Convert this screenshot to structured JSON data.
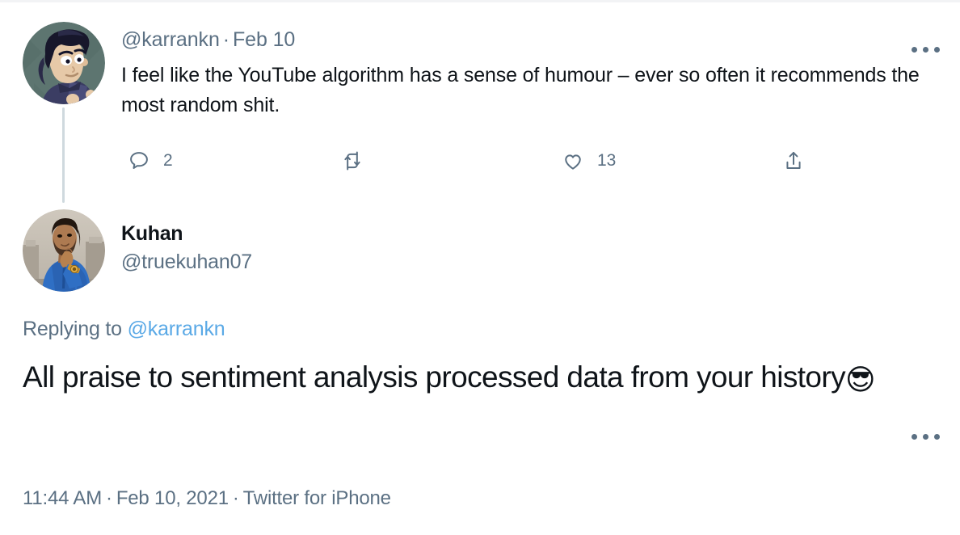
{
  "theme": {
    "background": "#ffffff",
    "text_primary": "#0f1419",
    "text_secondary": "#5b7083",
    "link_blue": "#5aa9e6",
    "thread_line": "#cfd9de"
  },
  "parent_tweet": {
    "avatar_alt": "karrankn-avatar",
    "handle": "@karrankn",
    "separator": "·",
    "date": "Feb 10",
    "body": "I feel like the YouTube algorithm has a sense of humour – ever so often it recommends the most random shit.",
    "more_label": "More",
    "actions": [
      {
        "name": "reply",
        "icon": "reply-icon",
        "count": "2"
      },
      {
        "name": "retweet",
        "icon": "retweet-icon",
        "count": ""
      },
      {
        "name": "like",
        "icon": "heart-icon",
        "count": "13"
      },
      {
        "name": "share",
        "icon": "share-icon",
        "count": ""
      }
    ]
  },
  "main_tweet": {
    "avatar_alt": "truekuhan07-avatar",
    "display_name": "Kuhan",
    "handle": "@truekuhan07",
    "more_label": "More",
    "replying_to_label": "Replying to",
    "replying_to_handle": "@karrankn",
    "body_text": "All praise to sentiment analysis processed data from your history",
    "body_emoji": "😎",
    "footer": {
      "time": "11:44 AM",
      "separator": "·",
      "date": "Feb 10, 2021",
      "source": "Twitter for iPhone"
    }
  }
}
